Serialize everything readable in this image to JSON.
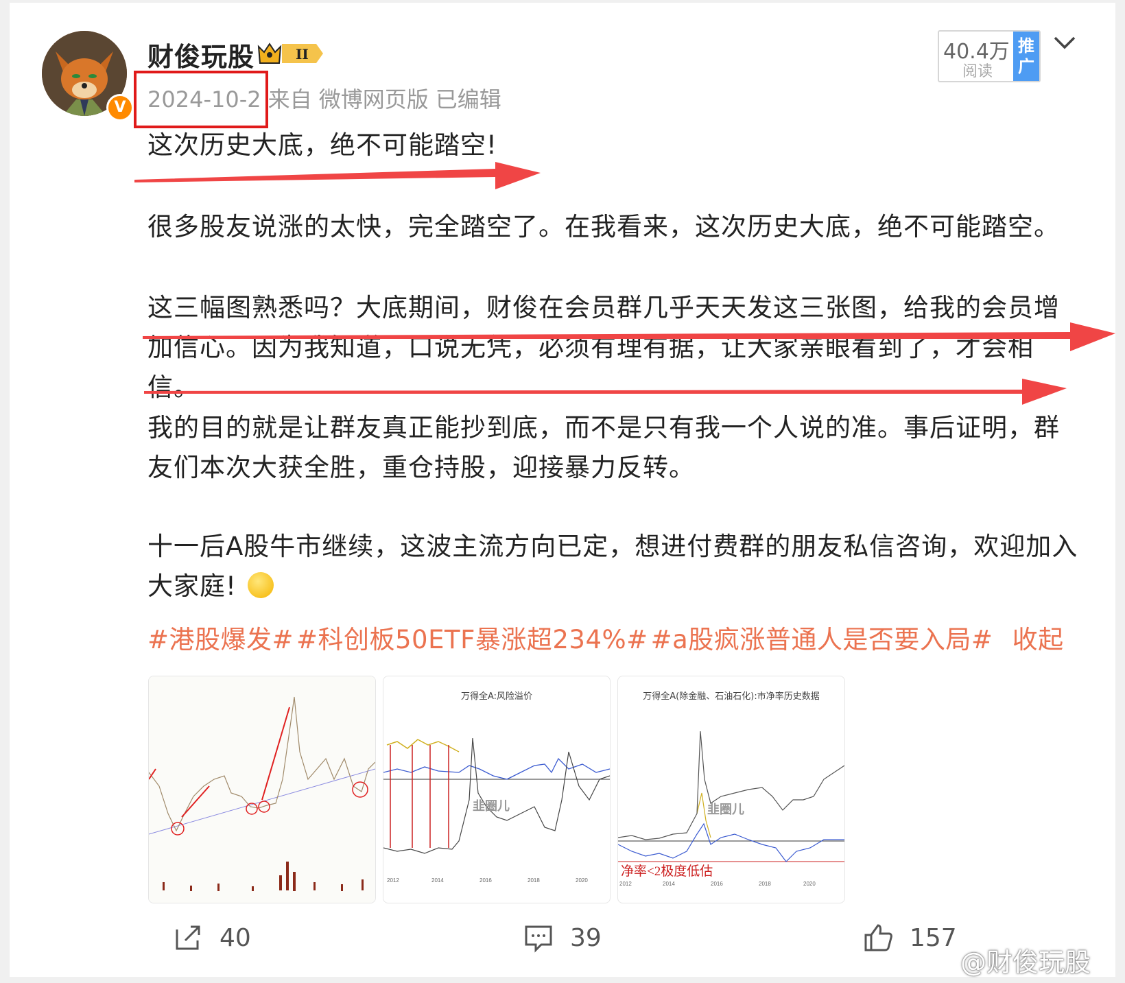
{
  "post": {
    "author": "财俊玩股",
    "level_badge": "II",
    "verified_badge": "V",
    "date": "2024-10-2",
    "source": "来自 微博网页版",
    "edited": "已编辑",
    "reads": "40.4万",
    "reads_label": "阅读",
    "promote_label": "推广",
    "paragraphs": [
      "这次历史大底，绝不可能踏空!",
      "很多股友说涨的太快，完全踏空了。在我看来，这次历史大底，绝不可能踏空。",
      "这三幅图熟悉吗？大底期间，财俊在会员群几乎天天发这三张图，给我的会员增加信心。因为我知道，口说无凭，必须有理有据，让大家亲眼看到了，才会相信。",
      "我的目的就是让群友真正能抄到底，而不是只有我一个人说的准。事后证明，群友们本次大获全胜，重仓持股，迎接暴力反转。",
      "十一后A股牛市继续，这波主流方向已定，想进付费群的朋友私信咨询，欢迎加入大家庭!"
    ],
    "hashtags": [
      "#港股爆发#",
      "#科创板50ETF暴涨超234%#",
      "#a股疯涨普通人是否要入局#"
    ],
    "collapse_label": "收起",
    "images": [
      {
        "title": ""
      },
      {
        "title": "万得全A:风险溢价",
        "x_ticks": [
          "2012",
          "2014",
          "2016",
          "2018",
          "2020"
        ],
        "watermark": "韭圈儿"
      },
      {
        "title": "万得全A(除金融、石油石化):市净率历史数据",
        "x_ticks": [
          "2012",
          "2014",
          "2016",
          "2018",
          "2020"
        ],
        "annotation": "净率<2极度低估",
        "watermark": "韭圈儿"
      }
    ],
    "actions": {
      "shares": "40",
      "comments": "39",
      "likes": "157"
    },
    "watermark": "@财俊玩股"
  },
  "colors": {
    "accent_orange": "#eb7350",
    "highlight_red": "#e01a1a",
    "promo_blue": "#4e9cf3"
  }
}
